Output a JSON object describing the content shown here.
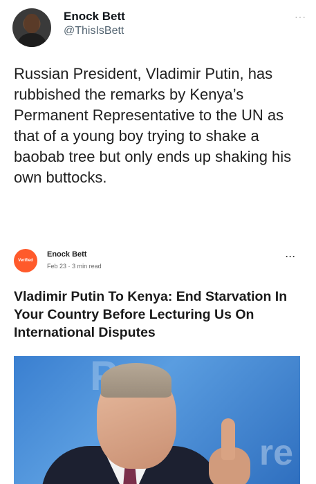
{
  "tweet": {
    "display_name": "Enock Bett",
    "handle": "@ThisIsBett",
    "more_icon": "ellipsis-icon",
    "text": "Russian President, Vladimir Putin, has rubbished the remarks by Kenya’s Permanent Representative to the UN as that of a young boy trying to shake a baobab tree but only ends up shaking his own buttocks."
  },
  "article_card": {
    "publisher_logo_text": "Verified",
    "author": "Enock Bett",
    "date": "Feb 23",
    "separator": "·",
    "read_time": "3 min read",
    "more_icon": "ellipsis-icon",
    "headline": "Vladimir Putin To Kenya: End Starvation In Your Country Before Lecturing Us On International Disputes",
    "image_alt": "photo-of-putin-pointing-finger"
  }
}
